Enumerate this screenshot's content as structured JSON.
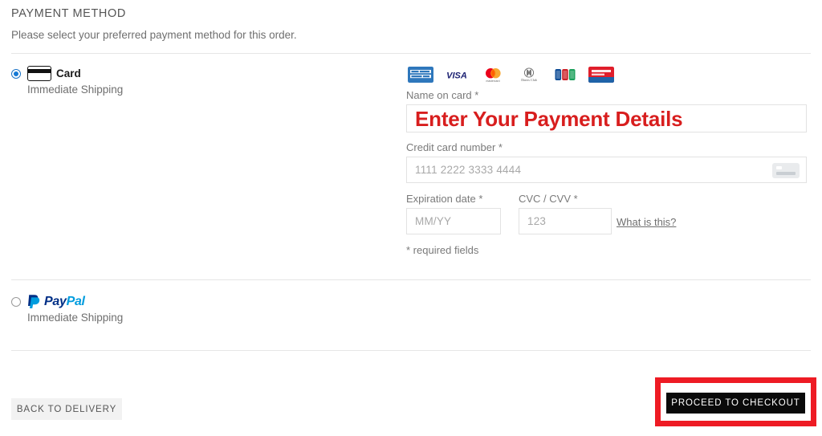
{
  "section": {
    "title": "PAYMENT METHOD",
    "subtitle": "Please select your preferred payment method for this order."
  },
  "methods": [
    {
      "id": "card",
      "label": "Card",
      "sublabel": "Immediate Shipping",
      "icon": "credit-card-icon",
      "selected": true
    },
    {
      "id": "paypal",
      "label": "PayPal",
      "label_part_a": "Pay",
      "label_part_b": "Pal",
      "sublabel": "Immediate Shipping",
      "icon": "paypal-icon",
      "selected": false
    }
  ],
  "accepted_brands": [
    {
      "name": "american-express",
      "label": "AMERICAN EXPRESS",
      "color": "#2e77bc"
    },
    {
      "name": "visa",
      "label": "VISA",
      "color": "#1a1f71"
    },
    {
      "name": "mastercard",
      "label": "mastercard",
      "color": "#eb001b"
    },
    {
      "name": "diners-club",
      "label": "Diners Club",
      "color": "#0079be"
    },
    {
      "name": "jcb",
      "label": "JCB",
      "color": "#0e4c96"
    },
    {
      "name": "discover",
      "label": "Discover",
      "color": "#e01e2b"
    }
  ],
  "form": {
    "name_on_card": {
      "label": "Name on card *",
      "value": "Enter Your Payment Details",
      "value_color": "#d81e1e"
    },
    "credit_card_number": {
      "label": "Credit card number *",
      "placeholder": "1111 2222 3333 4444",
      "value": "",
      "trailing_icon": "card-scan-icon"
    },
    "expiration_date": {
      "label": "Expiration date *",
      "placeholder": "MM/YY",
      "value": ""
    },
    "cvc": {
      "label": "CVC / CVV *",
      "placeholder": "123",
      "value": ""
    },
    "what_is_this_link": "What is this?",
    "required_note": "* required fields"
  },
  "footer": {
    "back_label": "BACK TO DELIVERY",
    "checkout_label": "PROCEED TO CHECKOUT",
    "highlight_color": "#ee1b24"
  }
}
